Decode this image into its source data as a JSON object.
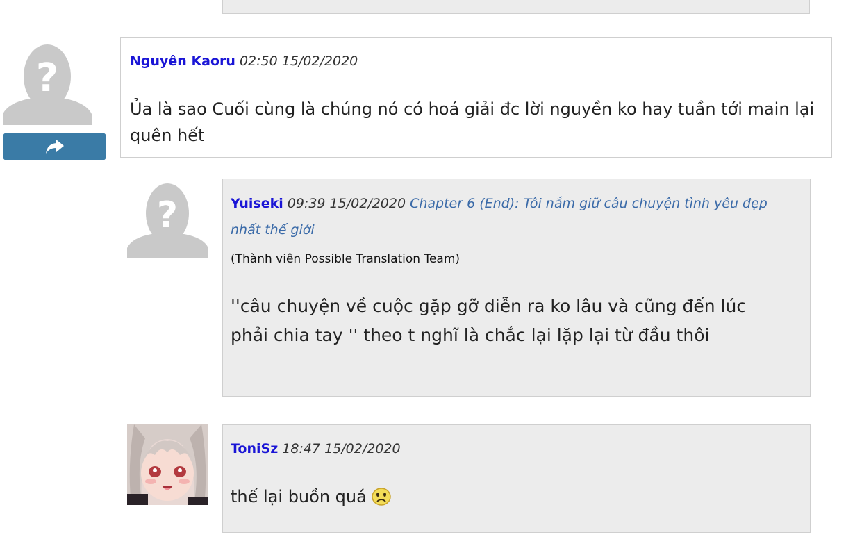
{
  "comments": [
    {
      "author": "Nguyên Kaoru",
      "time": "02:50 15/02/2020",
      "text": "Ủa là sao Cuối cùng là chúng nó có hoá giải đc lời nguyền ko hay tuần tới main lại quên hết",
      "avatar": "default-avatar",
      "reply_icon": "share-arrow-icon"
    },
    {
      "author": "Yuiseki",
      "time": "09:39 15/02/2020",
      "chapter": "Chapter 6 (End): Tôi nắm giữ câu chuyện tình yêu đẹp nhất thế giới",
      "team": "(Thành viên Possible Translation Team)",
      "text": "''câu chuyện về cuộc gặp gỡ diễn ra ko lâu và cũng đến lúc phải chia tay '' theo t nghĩ là chắc lại lặp lại từ đầu thôi",
      "avatar": "default-avatar"
    },
    {
      "author": "ToniSz",
      "time": "18:47 15/02/2020",
      "text": "thế lại buồn quá",
      "avatar": "anime-girl-avatar",
      "emoji": "sad-face-emoji"
    }
  ],
  "colors": {
    "author": "#1a15d6",
    "chapter_link": "#3a6aa8",
    "reply_button": "#3a7ba6",
    "reply_box_bg": "#ececec"
  }
}
